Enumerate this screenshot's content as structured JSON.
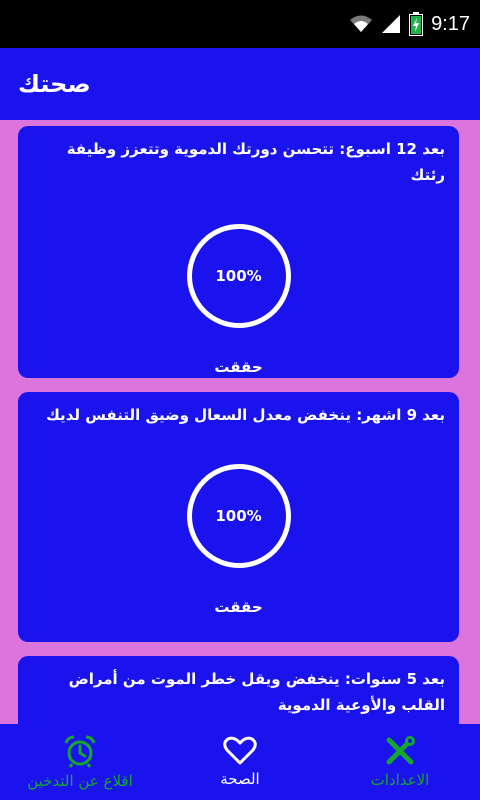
{
  "status_bar": {
    "time": "9:17",
    "icons": [
      "wifi-icon",
      "cell-signal-icon",
      "battery-charging-icon"
    ]
  },
  "app_bar": {
    "title": "صحتك"
  },
  "cards": [
    {
      "title": "بعد 12 اسبوع: تتحسن دورتك الدموية وتتعزز وظيفة رئتك",
      "progress_percent": 100,
      "progress_label": "100%",
      "status": "حققت"
    },
    {
      "title": "بعد 9 اشهر: ينخفض معدل السعال وضيق التنفس لديك",
      "progress_percent": 100,
      "progress_label": "100%",
      "status": "حققت"
    },
    {
      "title": "بعد 5 سنوات: ينخفض ويقل خطر الموت من أمراض القلب والأوعية الدموية"
    }
  ],
  "bottom_nav": {
    "items": [
      {
        "label": "اقلاع عن التدخين",
        "icon": "alarm-clock-icon"
      },
      {
        "label": "الصحة",
        "icon": "heart-icon"
      },
      {
        "label": "الاعدادات",
        "icon": "tools-icon"
      }
    ],
    "active_index": 1
  },
  "colors": {
    "primary": "#1b13ee",
    "background": "#dc74de",
    "nav_inactive": "#17a52e",
    "text": "#ffffff"
  }
}
